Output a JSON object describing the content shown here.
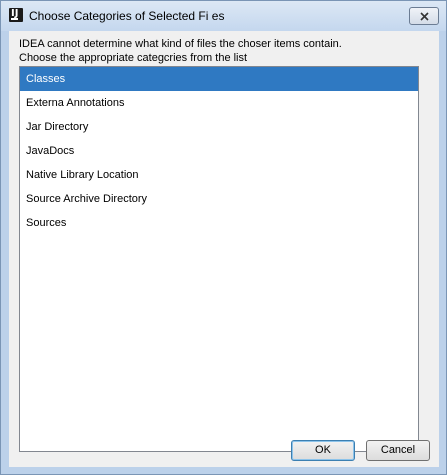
{
  "window": {
    "title": "Choose Categories of Selected Fi es"
  },
  "message": {
    "line1": "IDEA cannot determine what kind of files the choser items contain.",
    "line2": "Choose the appropriate categcries from the list"
  },
  "categories": {
    "items": [
      {
        "label": "Classes"
      },
      {
        "label": "Externa Annotations"
      },
      {
        "label": "Jar Directory"
      },
      {
        "label": "JavaDocs"
      },
      {
        "label": "Native Library Location"
      },
      {
        "label": "Source Archive Directory"
      },
      {
        "label": "Sources"
      }
    ],
    "selected": "Classes"
  },
  "buttons": {
    "ok_label": "OK",
    "cancel_label": "Cancel"
  },
  "colors": {
    "selection": "#2f79c2",
    "frame": "#bcd1ea"
  },
  "icons": {
    "app": "intellij-app-icon",
    "close": "close-icon"
  }
}
